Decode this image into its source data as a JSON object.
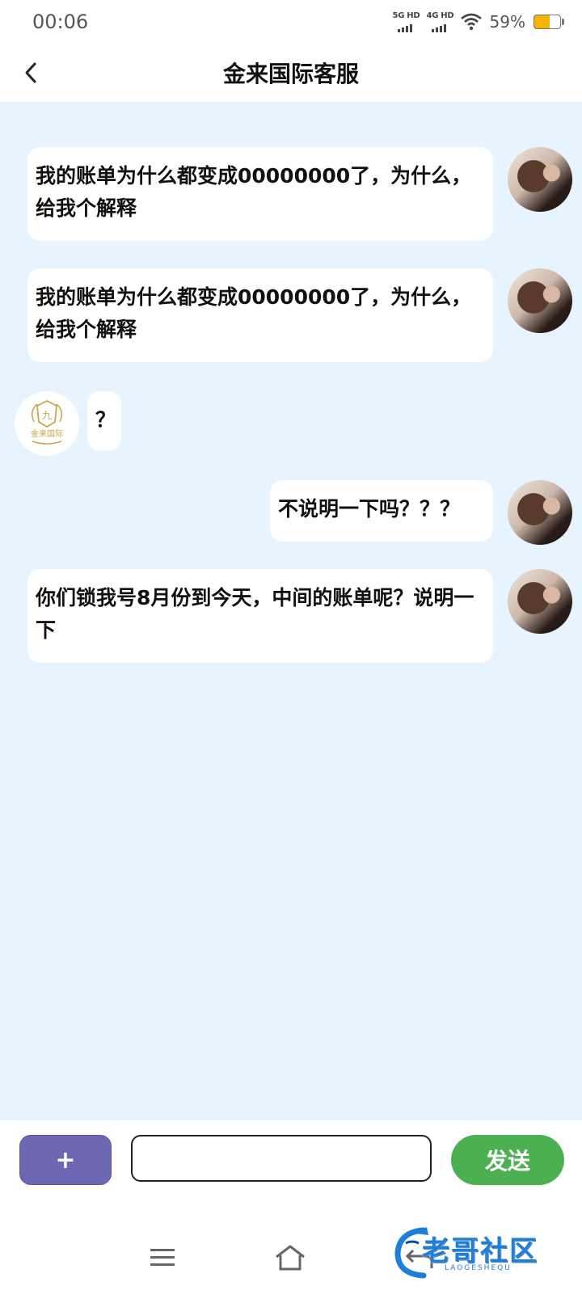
{
  "status_bar": {
    "time": "00:06",
    "network1": "5G HD",
    "network2": "4G HD",
    "battery_percent": "59%"
  },
  "header": {
    "title": "金来国际客服"
  },
  "messages": [
    {
      "side": "right",
      "text": "我的账单为什么都变成00000000了，为什么，给我个解释"
    },
    {
      "side": "right",
      "text": "我的账单为什么都变成00000000了，为什么，给我个解释"
    },
    {
      "side": "left",
      "text": "？"
    },
    {
      "side": "right",
      "text": "不说明一下吗？？？"
    },
    {
      "side": "right",
      "text": "你们锁我号8月份到今天，中间的账单呢？说明一下"
    }
  ],
  "agent_logo_text": "金来国际",
  "input_bar": {
    "plus_label": "+",
    "input_value": "",
    "send_label": "发送"
  },
  "watermark": {
    "text": "老哥社区",
    "sub": "LAOGESHEQU"
  },
  "colors": {
    "chat_bg": "#e7f3fd",
    "plus_button": "#6e67b3",
    "send_button": "#4caf50"
  }
}
